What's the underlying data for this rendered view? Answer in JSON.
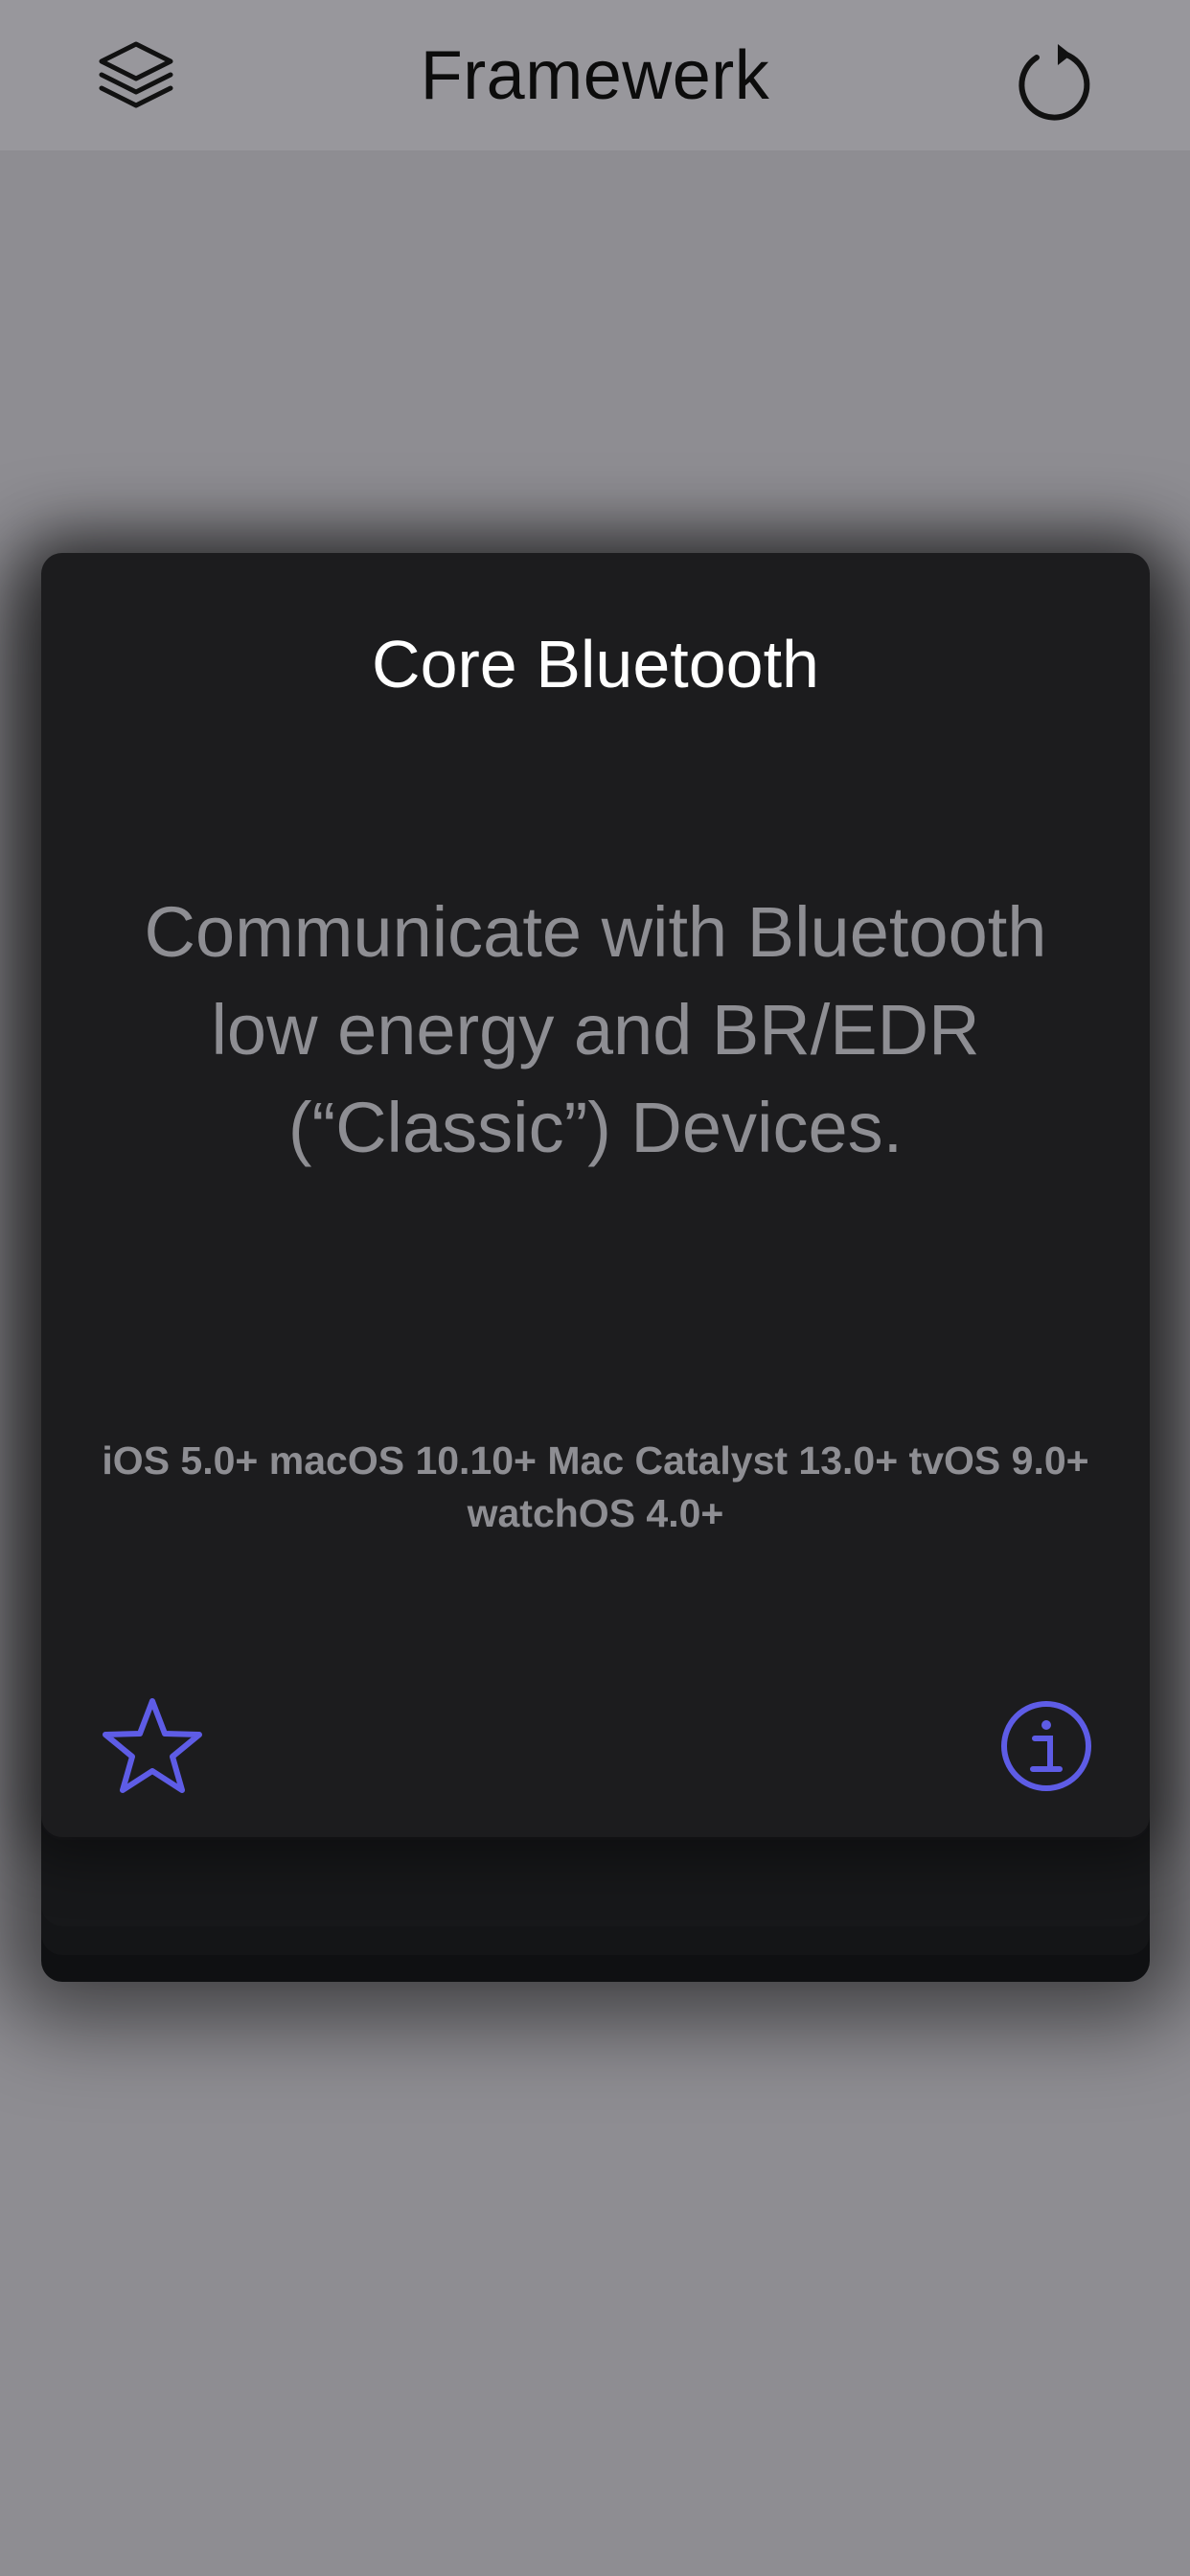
{
  "nav": {
    "title": "Framewerk",
    "left_icon": "layers-icon",
    "right_icon": "refresh-icon"
  },
  "card": {
    "title": "Core Bluetooth",
    "description": "Communicate with Bluetooth low energy and BR/EDR (“Classic”) Devices.",
    "platforms": "iOS 5.0+ macOS 10.10+ Mac Catalyst 13.0+ tvOS 9.0+ watchOS 4.0+",
    "favorite_icon": "star-icon",
    "info_icon": "info-icon"
  },
  "colors": {
    "accent": "#5e5ce6",
    "background": "#8e8d92",
    "navbar": "#98979c",
    "card": "#1c1c1e",
    "secondary_text": "#8e8e93"
  }
}
